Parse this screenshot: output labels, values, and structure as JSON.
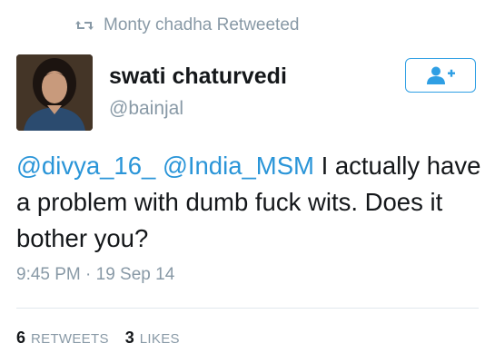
{
  "retweet": {
    "icon": "retweet-icon",
    "text": "Monty chadha Retweeted"
  },
  "author": {
    "name": "swati chaturvedi",
    "handle": "@bainjal",
    "avatar_icon": "avatar-photo"
  },
  "follow_button": {
    "icon": "add-user-icon",
    "color": "#2f9fe4"
  },
  "tweet": {
    "mentions": [
      "@divya_16_",
      "@India_MSM"
    ],
    "body_line1": "I actually",
    "body_rest": "have a problem with dumb fuck wits. Does it bother you?",
    "timestamp": "9:45 PM · 19 Sep 14"
  },
  "stats": {
    "retweets_count": "6",
    "retweets_label": "RETWEETS",
    "likes_count": "3",
    "likes_label": "LIKES"
  },
  "colors": {
    "link": "#2a95d8",
    "muted": "#8899a6",
    "text": "#14171a"
  }
}
